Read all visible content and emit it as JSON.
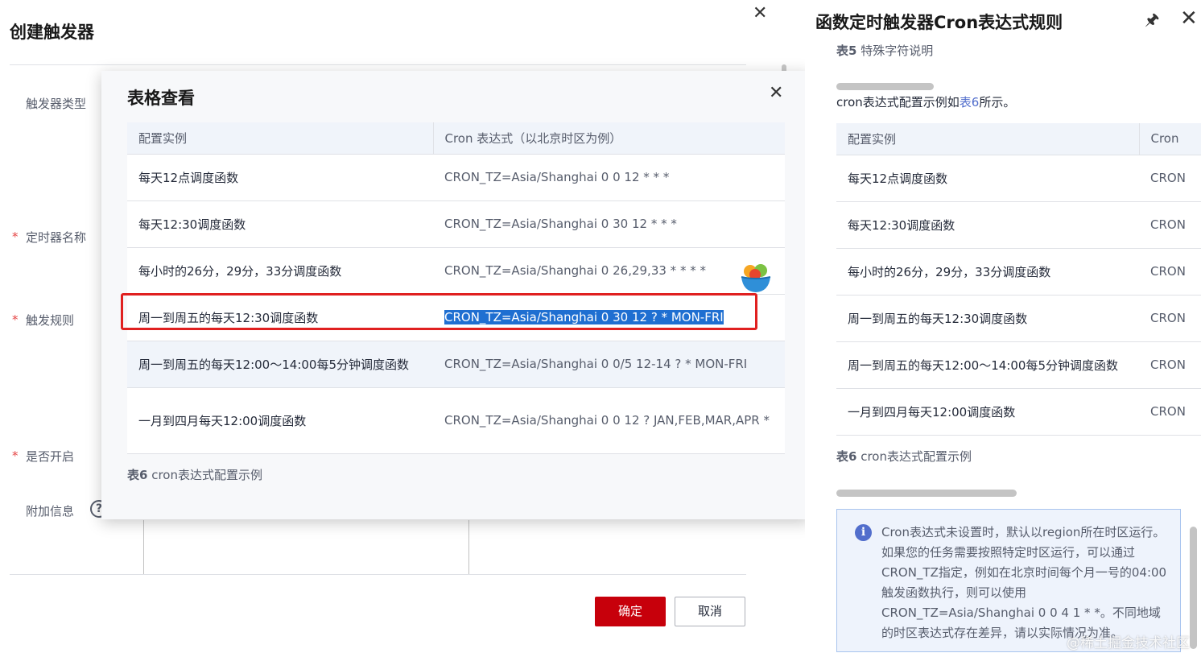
{
  "left_panel": {
    "title": "创建触发器",
    "close": "✕",
    "labels": {
      "trigger_type": "触发器类型",
      "timer_name": "定时器名称",
      "trigger_rule": "触发规则",
      "enabled": "是否开启",
      "extra_info": "附加信息"
    },
    "required_mark": "*",
    "help_icon": "?",
    "buttons": {
      "ok": "确定",
      "cancel": "取消"
    }
  },
  "modal": {
    "title": "表格查看",
    "close": "✕",
    "headers": [
      "配置实例",
      "Cron 表达式（以北京时区为例）"
    ],
    "rows": [
      {
        "desc": "每天12点调度函数",
        "cron": "CRON_TZ=Asia/Shanghai 0 0 12 * * *"
      },
      {
        "desc": "每天12:30调度函数",
        "cron": "CRON_TZ=Asia/Shanghai 0 30 12 * * *"
      },
      {
        "desc": "每小时的26分，29分，33分调度函数",
        "cron": "CRON_TZ=Asia/Shanghai 0 26,29,33 * * * *"
      },
      {
        "desc": "周一到周五的每天12:30调度函数",
        "cron": "CRON_TZ=Asia/Shanghai 0 30 12 ? * MON-FRI"
      },
      {
        "desc": "周一到周五的每天12:00～14:00每5分钟调度函数",
        "cron": "CRON_TZ=Asia/Shanghai 0 0/5 12-14 ? * MON-FRI"
      },
      {
        "desc": "一月到四月每天12:00调度函数",
        "cron": "CRON_TZ=Asia/Shanghai 0 0 12 ? JAN,FEB,MAR,APR *"
      }
    ],
    "caption_num": "表6",
    "caption_text": " cron表达式配置示例"
  },
  "right_panel": {
    "title": "函数定时触发器Cron表达式规则",
    "pin_icon": "🖈",
    "close": "✕",
    "cap5_num": "表5",
    "cap5_text": " 特殊字符说明",
    "intro_before": "cron表达式配置示例如",
    "intro_link": "表6",
    "intro_after": "所示。",
    "headers": [
      "配置实例",
      "Cron"
    ],
    "rows": [
      {
        "desc": "每天12点调度函数",
        "cron": "CRON"
      },
      {
        "desc": "每天12:30调度函数",
        "cron": "CRON"
      },
      {
        "desc": "每小时的26分，29分，33分调度函数",
        "cron": "CRON"
      },
      {
        "desc": "周一到周五的每天12:30调度函数",
        "cron": "CRON"
      },
      {
        "desc": "周一到周五的每天12:00～14:00每5分钟调度函数",
        "cron": "CRON"
      },
      {
        "desc": "一月到四月每天12:00调度函数",
        "cron": "CRON"
      }
    ],
    "cap6_num": "表6",
    "cap6_text": " cron表达式配置示例",
    "note_icon": "i",
    "note": "Cron表达式未设置时，默认以region所在时区运行。如果您的任务需要按照特定时区运行，可以通过CRON_TZ指定，例如在北京时间每个月一号的04:00触发函数执行，则可以使用CRON_TZ=Asia/Shanghai 0 0 4 1 * *。不同地域的时区表达式存在差异，请以实际情况为准。"
  },
  "watermark": "@稀土掘金技术社区",
  "colors": {
    "primary_button": "#c7000b",
    "link": "#526ecc",
    "selection": "#1f6fd1",
    "highlight_box": "#e02020"
  }
}
